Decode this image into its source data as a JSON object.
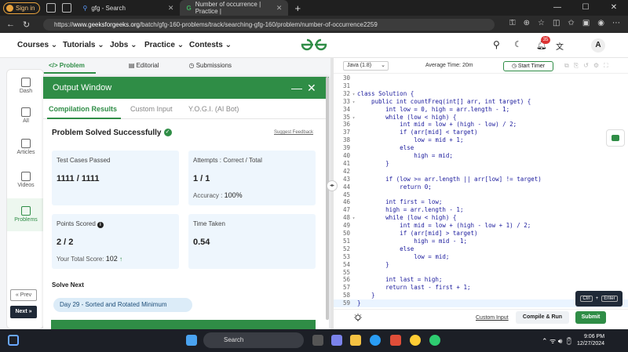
{
  "browser": {
    "signin_label": "Sign in",
    "tabs": [
      {
        "title": "gfg - Search",
        "active": false
      },
      {
        "title": "Number of occurrence | Practice |",
        "active": true
      }
    ],
    "url_host": "www.geeksforgeeks.org",
    "url_path": "/batch/gfg-160-problems/track/searching-gfg-160/problem/number-of-occurrence2259",
    "url_scheme": "https://",
    "notification_count": "35",
    "profile_initial": "A"
  },
  "site": {
    "nav": [
      "Courses",
      "Tutorials",
      "Jobs",
      "Practice",
      "Contests"
    ],
    "logo_text": "GfG"
  },
  "problem_tabs": [
    "Problem",
    "Editorial",
    "Submissions"
  ],
  "sidenav": [
    {
      "label": "Dash",
      "active": false
    },
    {
      "label": "All",
      "active": false
    },
    {
      "label": "Articles",
      "active": false
    },
    {
      "label": "Videos",
      "active": false
    },
    {
      "label": "Problems",
      "active": true
    }
  ],
  "pager": {
    "prev": "« Prev",
    "next": "Next »"
  },
  "output": {
    "title": "Output Window",
    "tabs": [
      "Compilation Results",
      "Custom Input",
      "Y.O.G.I. (AI Bot)"
    ],
    "status": "Problem Solved Successfully",
    "suggest_feedback": "Suggest Feedback",
    "cards": {
      "tests_label": "Test Cases Passed",
      "tests_value": "1111 / 1111",
      "attempts_label": "Attempts : Correct / Total",
      "attempts_value": "1 / 1",
      "accuracy_label": "Accuracy :",
      "accuracy_value": "100%",
      "points_label": "Points Scored",
      "points_value": "2 / 2",
      "total_score_label": "Your Total Score:",
      "total_score_value": "102",
      "time_label": "Time Taken",
      "time_value": "0.54"
    },
    "solve_next": "Solve Next",
    "next_problem": "Day 29 - Sorted and Rotated Minimum"
  },
  "editor": {
    "language": "Java (1.8)",
    "avg_time": "Average Time: 20m",
    "start_timer": "Start Timer",
    "lines": [
      {
        "n": "30",
        "fold": "",
        "t": ""
      },
      {
        "n": "31",
        "fold": "",
        "t": ""
      },
      {
        "n": "32",
        "fold": "▾",
        "t": "class Solution {"
      },
      {
        "n": "33",
        "fold": "▾",
        "t": "    public int countFreq(int[] arr, int target) {"
      },
      {
        "n": "34",
        "fold": "",
        "t": "        int low = 0, high = arr.length - 1;"
      },
      {
        "n": "35",
        "fold": "▾",
        "t": "        while (low < high) {"
      },
      {
        "n": "36",
        "fold": "",
        "t": "            int mid = low + (high - low) / 2;"
      },
      {
        "n": "37",
        "fold": "",
        "t": "            if (arr[mid] < target)"
      },
      {
        "n": "38",
        "fold": "",
        "t": "                low = mid + 1;"
      },
      {
        "n": "39",
        "fold": "",
        "t": "            else"
      },
      {
        "n": "40",
        "fold": "",
        "t": "                high = mid;"
      },
      {
        "n": "41",
        "fold": "",
        "t": "        }"
      },
      {
        "n": "42",
        "fold": "",
        "t": ""
      },
      {
        "n": "43",
        "fold": "",
        "t": "        if (low >= arr.length || arr[low] != target)"
      },
      {
        "n": "44",
        "fold": "",
        "t": "            return 0;"
      },
      {
        "n": "45",
        "fold": "",
        "t": ""
      },
      {
        "n": "46",
        "fold": "",
        "t": "        int first = low;"
      },
      {
        "n": "47",
        "fold": "",
        "t": "        high = arr.length - 1;"
      },
      {
        "n": "48",
        "fold": "▾",
        "t": "        while (low < high) {"
      },
      {
        "n": "49",
        "fold": "",
        "t": "            int mid = low + (high - low + 1) / 2;"
      },
      {
        "n": "50",
        "fold": "",
        "t": "            if (arr[mid] > target)"
      },
      {
        "n": "51",
        "fold": "",
        "t": "                high = mid - 1;"
      },
      {
        "n": "52",
        "fold": "",
        "t": "            else"
      },
      {
        "n": "53",
        "fold": "",
        "t": "                low = mid;"
      },
      {
        "n": "54",
        "fold": "",
        "t": "        }"
      },
      {
        "n": "55",
        "fold": "",
        "t": ""
      },
      {
        "n": "56",
        "fold": "",
        "t": "        int last = high;"
      },
      {
        "n": "57",
        "fold": "",
        "t": "        return last - first + 1;"
      },
      {
        "n": "58",
        "fold": "",
        "t": "    }"
      },
      {
        "n": "59",
        "fold": "",
        "t": "}"
      }
    ],
    "custom_input": "Custom Input",
    "compile_run": "Compile & Run",
    "submit": "Submit",
    "shortcut_key1": "Ctrl",
    "shortcut_plus": "+",
    "shortcut_key2": "Enter"
  },
  "taskbar": {
    "search_placeholder": "Search",
    "time": "9:06 PM",
    "date": "12/27/2024"
  },
  "colors": {
    "brand": "#2f8d46",
    "card": "#eef6fd",
    "dark": "#1f2937"
  }
}
